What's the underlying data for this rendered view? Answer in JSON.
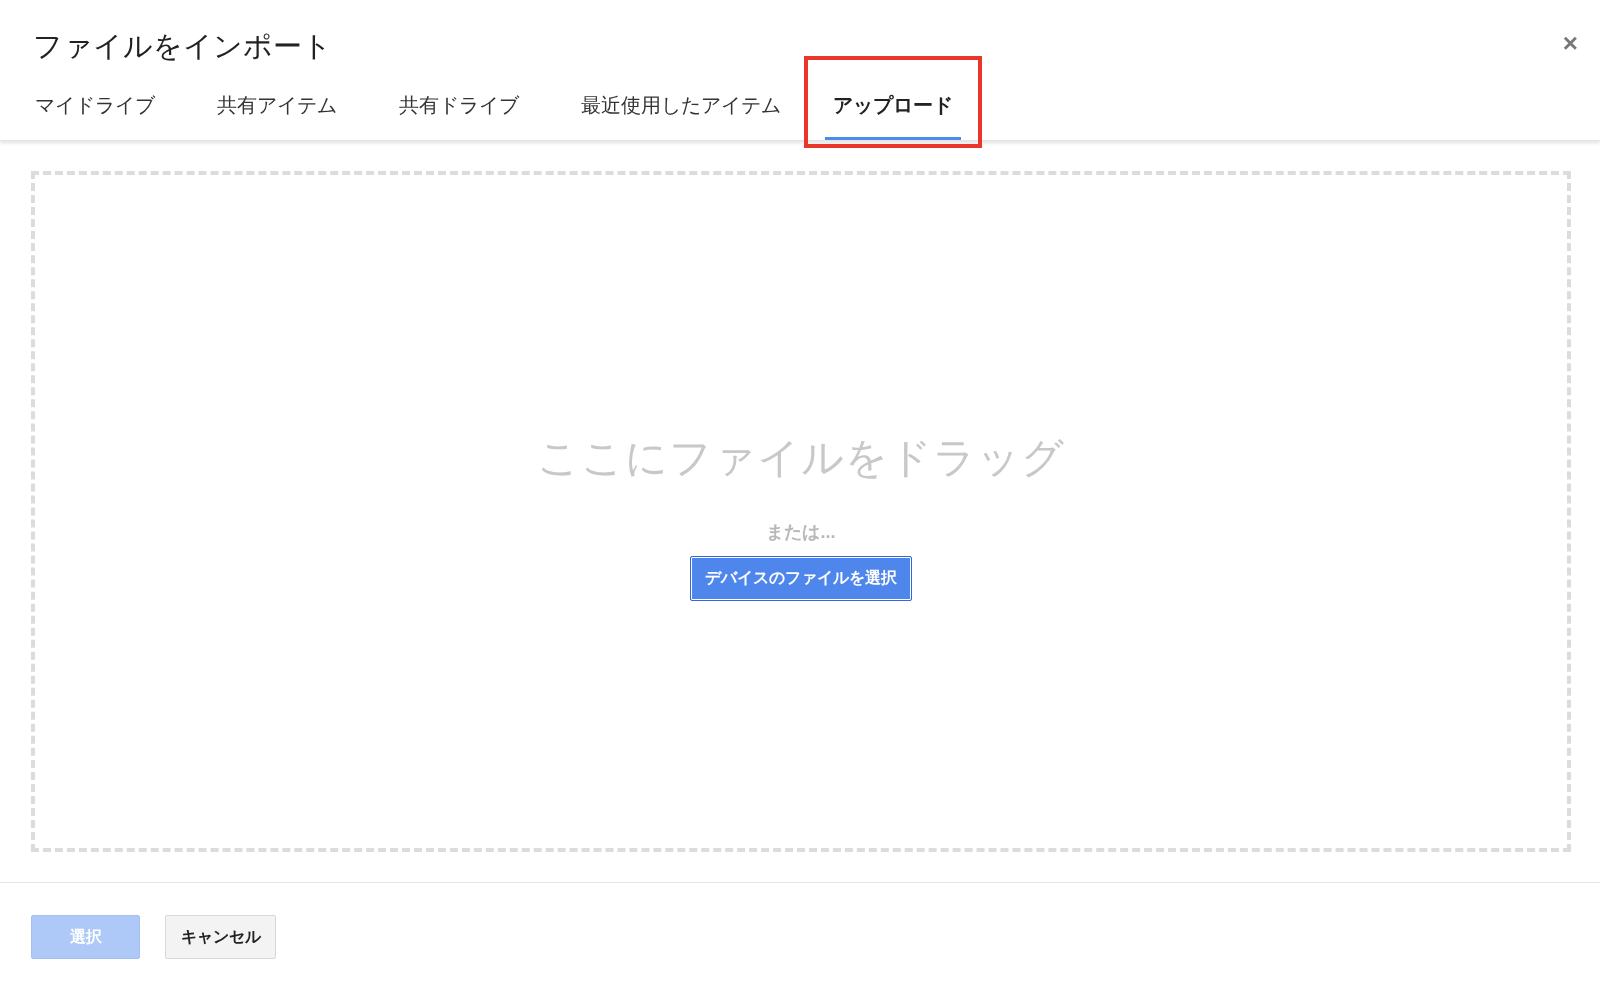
{
  "dialog": {
    "title": "ファイルをインポート",
    "close": "×"
  },
  "tabs": [
    {
      "label": "マイドライブ",
      "selected": false,
      "highlighted": false
    },
    {
      "label": "共有アイテム",
      "selected": false,
      "highlighted": false
    },
    {
      "label": "共有ドライブ",
      "selected": false,
      "highlighted": false
    },
    {
      "label": "最近使用したアイテム",
      "selected": false,
      "highlighted": false
    },
    {
      "label": "アップロード",
      "selected": true,
      "highlighted": true
    }
  ],
  "drop_zone": {
    "heading": "ここにファイルをドラッグ",
    "separator": "または...",
    "button": "デバイスのファイルを選択"
  },
  "footer_buttons": [
    {
      "label": "選択",
      "kind": "primary",
      "disabled": true
    },
    {
      "label": "キャンセル",
      "kind": "secondary",
      "disabled": false
    }
  ]
}
